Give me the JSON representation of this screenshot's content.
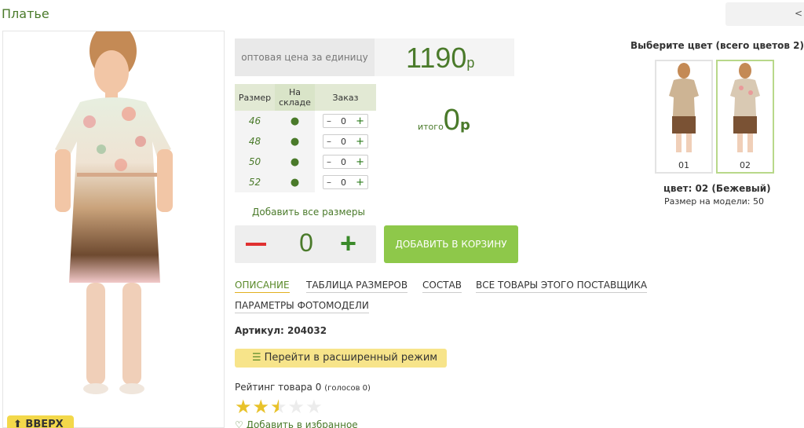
{
  "product": {
    "title": "Платье",
    "article_label": "Артикул: 204032"
  },
  "top_right": {
    "label": "<"
  },
  "photo": {
    "up_button": "⬆ ВВЕРХ"
  },
  "price": {
    "label": "оптовая цена за единицу",
    "value": "1190",
    "currency": "р"
  },
  "size_table": {
    "headers": [
      "Размер",
      "На складе",
      "Заказ"
    ],
    "rows": [
      {
        "size": "46",
        "stock": "●",
        "qty": "0"
      },
      {
        "size": "48",
        "stock": "●",
        "qty": "0"
      },
      {
        "size": "50",
        "stock": "●",
        "qty": "0"
      },
      {
        "size": "52",
        "stock": "●",
        "qty": "0"
      }
    ],
    "minus": "–",
    "plus": "+"
  },
  "total": {
    "label": "итого",
    "value": "0",
    "currency": "р"
  },
  "add_all_sizes": "Добавить все размеры",
  "quantity": {
    "value": "0",
    "plus": "+"
  },
  "cart_button": "ДОБАВИТЬ В КОРЗИНУ",
  "tabs": [
    {
      "label": "ОПИСАНИЕ",
      "active": true
    },
    {
      "label": "ТАБЛИЦА РАЗМЕРОВ"
    },
    {
      "label": "СОСТАВ"
    },
    {
      "label": "ВСЕ ТОВАРЫ ЭТОГО ПОСТАВЩИКА"
    },
    {
      "label": "ПАРАМЕТРЫ ФОТОМОДЕЛИ"
    }
  ],
  "expand_button": {
    "icon": "list-icon",
    "label": "Перейти в расширенный режим"
  },
  "rating": {
    "label": "Рейтинг товара 0",
    "votes": "(голосов 0)",
    "stars_filled": 2.5,
    "stars_total": 5
  },
  "favorite": {
    "icon": "heart-icon",
    "label": "Добавить в избранное"
  },
  "colors": {
    "title": "Выберите цвет (всего цветов 2)",
    "items": [
      {
        "label": "01",
        "selected": false
      },
      {
        "label": "02",
        "selected": true
      }
    ],
    "current": "цвет: 02 (Бежевый)",
    "model_size": "Размер на модели: 50"
  },
  "palette": {
    "brand_green": "#4a7a2a",
    "button_green": "#8ec84a",
    "yellow": "#f7e48a",
    "minus_red": "#e03030"
  }
}
